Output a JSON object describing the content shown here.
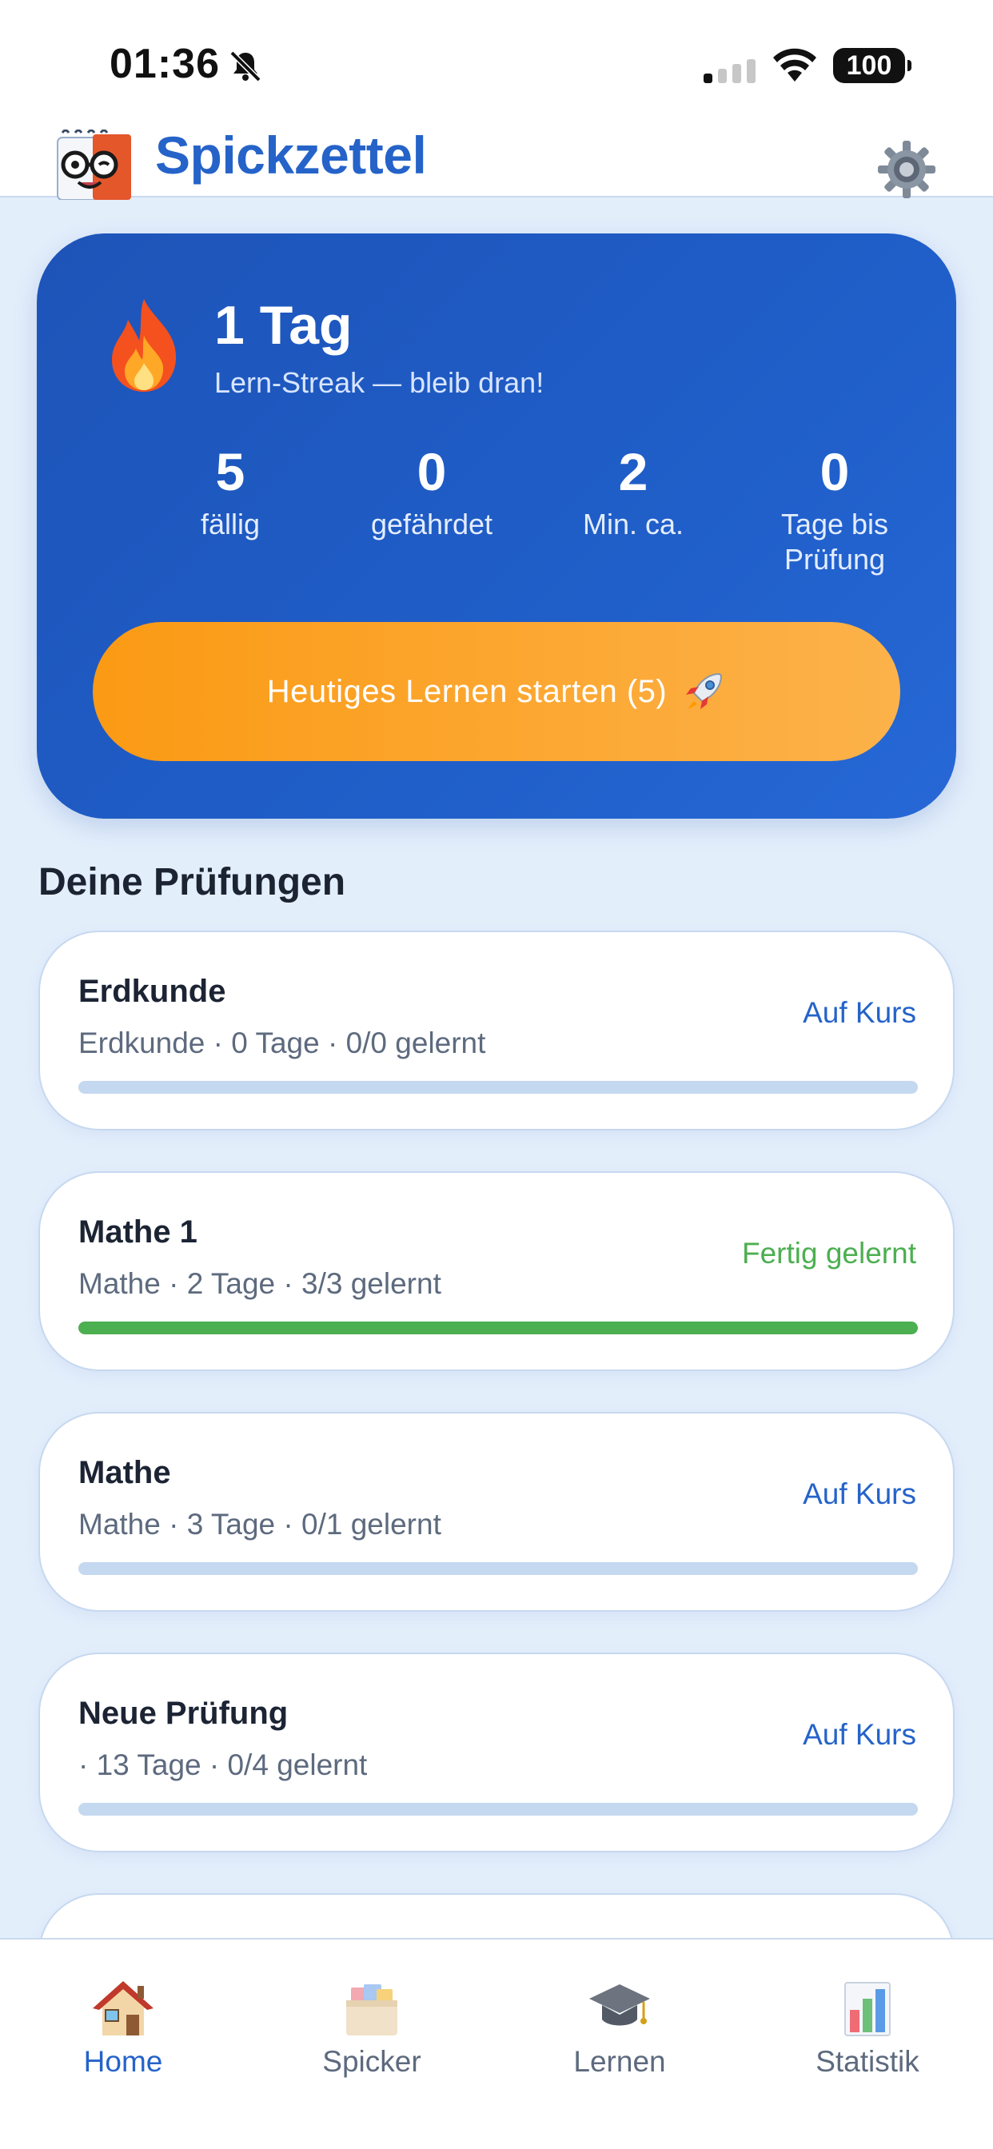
{
  "status_bar": {
    "time": "01:36",
    "battery": "100"
  },
  "header": {
    "title": "Spickzettel"
  },
  "hero": {
    "streak_title": "1 Tag",
    "streak_subtitle": "Lern-Streak — bleib dran!",
    "stats": [
      {
        "value": "5",
        "label": "fällig"
      },
      {
        "value": "0",
        "label": "gefährdet"
      },
      {
        "value": "2",
        "label": "Min. ca."
      },
      {
        "value": "0",
        "label": "Tage bis Prüfung"
      }
    ],
    "start_button_label": "Heutiges Lernen starten (5)"
  },
  "exams": {
    "section_title": "Deine Prüfungen",
    "items": [
      {
        "name": "Erdkunde",
        "meta": "Erdkunde · 0 Tage · 0/0 gelernt",
        "status": "Auf Kurs",
        "progress": 0
      },
      {
        "name": "Mathe 1",
        "meta": "Mathe · 2 Tage · 3/3 gelernt",
        "status": "Fertig gelernt",
        "progress": 1
      },
      {
        "name": "Mathe",
        "meta": "Mathe · 3 Tage · 0/1 gelernt",
        "status": "Auf Kurs",
        "progress": 0
      },
      {
        "name": "Neue Prüfung",
        "meta": " · 13 Tage · 0/4 gelernt",
        "status": "Auf Kurs",
        "progress": 0
      }
    ]
  },
  "tabbar": {
    "items": [
      {
        "label": "Home",
        "icon": "house-icon",
        "active": true
      },
      {
        "label": "Spicker",
        "icon": "card-box-icon",
        "active": false
      },
      {
        "label": "Lernen",
        "icon": "graduation-cap-icon",
        "active": false
      },
      {
        "label": "Statistik",
        "icon": "bar-chart-icon",
        "active": false
      }
    ]
  },
  "colors": {
    "accent": "#2563c9",
    "hero_blue": "#1f5dc7",
    "button_orange": "#fb9a14",
    "success_green": "#4caf50",
    "background": "#e3eefb"
  }
}
